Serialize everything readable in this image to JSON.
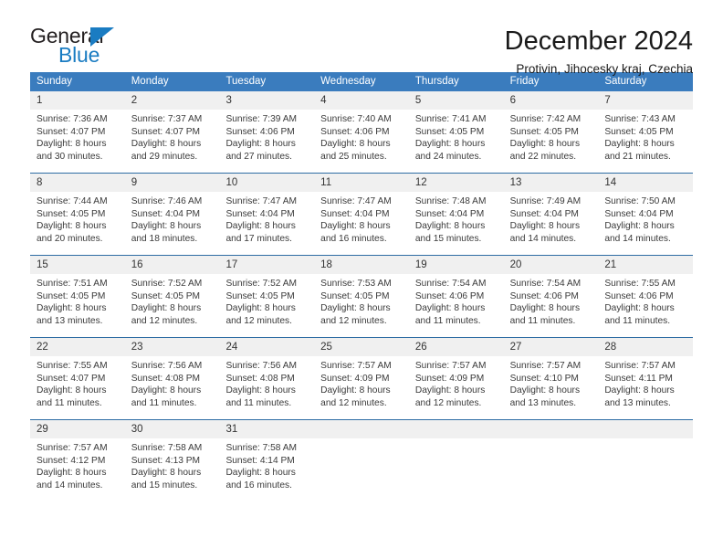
{
  "logo": {
    "word1": "General",
    "word2": "Blue",
    "accent_color": "#1a7cc2"
  },
  "header": {
    "title": "December 2024",
    "subtitle": "Protivin, Jihocesky kraj, Czechia"
  },
  "theme": {
    "header_row_bg": "#3a7cbe",
    "daynum_bg": "#f0f0f0",
    "divider": "#2e6da4",
    "text": "#3a3a3a"
  },
  "weekdays": [
    "Sunday",
    "Monday",
    "Tuesday",
    "Wednesday",
    "Thursday",
    "Friday",
    "Saturday"
  ],
  "weeks": [
    [
      {
        "day": "1",
        "sunrise": "Sunrise: 7:36 AM",
        "sunset": "Sunset: 4:07 PM",
        "daylight1": "Daylight: 8 hours",
        "daylight2": "and 30 minutes."
      },
      {
        "day": "2",
        "sunrise": "Sunrise: 7:37 AM",
        "sunset": "Sunset: 4:07 PM",
        "daylight1": "Daylight: 8 hours",
        "daylight2": "and 29 minutes."
      },
      {
        "day": "3",
        "sunrise": "Sunrise: 7:39 AM",
        "sunset": "Sunset: 4:06 PM",
        "daylight1": "Daylight: 8 hours",
        "daylight2": "and 27 minutes."
      },
      {
        "day": "4",
        "sunrise": "Sunrise: 7:40 AM",
        "sunset": "Sunset: 4:06 PM",
        "daylight1": "Daylight: 8 hours",
        "daylight2": "and 25 minutes."
      },
      {
        "day": "5",
        "sunrise": "Sunrise: 7:41 AM",
        "sunset": "Sunset: 4:05 PM",
        "daylight1": "Daylight: 8 hours",
        "daylight2": "and 24 minutes."
      },
      {
        "day": "6",
        "sunrise": "Sunrise: 7:42 AM",
        "sunset": "Sunset: 4:05 PM",
        "daylight1": "Daylight: 8 hours",
        "daylight2": "and 22 minutes."
      },
      {
        "day": "7",
        "sunrise": "Sunrise: 7:43 AM",
        "sunset": "Sunset: 4:05 PM",
        "daylight1": "Daylight: 8 hours",
        "daylight2": "and 21 minutes."
      }
    ],
    [
      {
        "day": "8",
        "sunrise": "Sunrise: 7:44 AM",
        "sunset": "Sunset: 4:05 PM",
        "daylight1": "Daylight: 8 hours",
        "daylight2": "and 20 minutes."
      },
      {
        "day": "9",
        "sunrise": "Sunrise: 7:46 AM",
        "sunset": "Sunset: 4:04 PM",
        "daylight1": "Daylight: 8 hours",
        "daylight2": "and 18 minutes."
      },
      {
        "day": "10",
        "sunrise": "Sunrise: 7:47 AM",
        "sunset": "Sunset: 4:04 PM",
        "daylight1": "Daylight: 8 hours",
        "daylight2": "and 17 minutes."
      },
      {
        "day": "11",
        "sunrise": "Sunrise: 7:47 AM",
        "sunset": "Sunset: 4:04 PM",
        "daylight1": "Daylight: 8 hours",
        "daylight2": "and 16 minutes."
      },
      {
        "day": "12",
        "sunrise": "Sunrise: 7:48 AM",
        "sunset": "Sunset: 4:04 PM",
        "daylight1": "Daylight: 8 hours",
        "daylight2": "and 15 minutes."
      },
      {
        "day": "13",
        "sunrise": "Sunrise: 7:49 AM",
        "sunset": "Sunset: 4:04 PM",
        "daylight1": "Daylight: 8 hours",
        "daylight2": "and 14 minutes."
      },
      {
        "day": "14",
        "sunrise": "Sunrise: 7:50 AM",
        "sunset": "Sunset: 4:04 PM",
        "daylight1": "Daylight: 8 hours",
        "daylight2": "and 14 minutes."
      }
    ],
    [
      {
        "day": "15",
        "sunrise": "Sunrise: 7:51 AM",
        "sunset": "Sunset: 4:05 PM",
        "daylight1": "Daylight: 8 hours",
        "daylight2": "and 13 minutes."
      },
      {
        "day": "16",
        "sunrise": "Sunrise: 7:52 AM",
        "sunset": "Sunset: 4:05 PM",
        "daylight1": "Daylight: 8 hours",
        "daylight2": "and 12 minutes."
      },
      {
        "day": "17",
        "sunrise": "Sunrise: 7:52 AM",
        "sunset": "Sunset: 4:05 PM",
        "daylight1": "Daylight: 8 hours",
        "daylight2": "and 12 minutes."
      },
      {
        "day": "18",
        "sunrise": "Sunrise: 7:53 AM",
        "sunset": "Sunset: 4:05 PM",
        "daylight1": "Daylight: 8 hours",
        "daylight2": "and 12 minutes."
      },
      {
        "day": "19",
        "sunrise": "Sunrise: 7:54 AM",
        "sunset": "Sunset: 4:06 PM",
        "daylight1": "Daylight: 8 hours",
        "daylight2": "and 11 minutes."
      },
      {
        "day": "20",
        "sunrise": "Sunrise: 7:54 AM",
        "sunset": "Sunset: 4:06 PM",
        "daylight1": "Daylight: 8 hours",
        "daylight2": "and 11 minutes."
      },
      {
        "day": "21",
        "sunrise": "Sunrise: 7:55 AM",
        "sunset": "Sunset: 4:06 PM",
        "daylight1": "Daylight: 8 hours",
        "daylight2": "and 11 minutes."
      }
    ],
    [
      {
        "day": "22",
        "sunrise": "Sunrise: 7:55 AM",
        "sunset": "Sunset: 4:07 PM",
        "daylight1": "Daylight: 8 hours",
        "daylight2": "and 11 minutes."
      },
      {
        "day": "23",
        "sunrise": "Sunrise: 7:56 AM",
        "sunset": "Sunset: 4:08 PM",
        "daylight1": "Daylight: 8 hours",
        "daylight2": "and 11 minutes."
      },
      {
        "day": "24",
        "sunrise": "Sunrise: 7:56 AM",
        "sunset": "Sunset: 4:08 PM",
        "daylight1": "Daylight: 8 hours",
        "daylight2": "and 11 minutes."
      },
      {
        "day": "25",
        "sunrise": "Sunrise: 7:57 AM",
        "sunset": "Sunset: 4:09 PM",
        "daylight1": "Daylight: 8 hours",
        "daylight2": "and 12 minutes."
      },
      {
        "day": "26",
        "sunrise": "Sunrise: 7:57 AM",
        "sunset": "Sunset: 4:09 PM",
        "daylight1": "Daylight: 8 hours",
        "daylight2": "and 12 minutes."
      },
      {
        "day": "27",
        "sunrise": "Sunrise: 7:57 AM",
        "sunset": "Sunset: 4:10 PM",
        "daylight1": "Daylight: 8 hours",
        "daylight2": "and 13 minutes."
      },
      {
        "day": "28",
        "sunrise": "Sunrise: 7:57 AM",
        "sunset": "Sunset: 4:11 PM",
        "daylight1": "Daylight: 8 hours",
        "daylight2": "and 13 minutes."
      }
    ],
    [
      {
        "day": "29",
        "sunrise": "Sunrise: 7:57 AM",
        "sunset": "Sunset: 4:12 PM",
        "daylight1": "Daylight: 8 hours",
        "daylight2": "and 14 minutes."
      },
      {
        "day": "30",
        "sunrise": "Sunrise: 7:58 AM",
        "sunset": "Sunset: 4:13 PM",
        "daylight1": "Daylight: 8 hours",
        "daylight2": "and 15 minutes."
      },
      {
        "day": "31",
        "sunrise": "Sunrise: 7:58 AM",
        "sunset": "Sunset: 4:14 PM",
        "daylight1": "Daylight: 8 hours",
        "daylight2": "and 16 minutes."
      },
      {
        "day": "",
        "sunrise": "",
        "sunset": "",
        "daylight1": "",
        "daylight2": ""
      },
      {
        "day": "",
        "sunrise": "",
        "sunset": "",
        "daylight1": "",
        "daylight2": ""
      },
      {
        "day": "",
        "sunrise": "",
        "sunset": "",
        "daylight1": "",
        "daylight2": ""
      },
      {
        "day": "",
        "sunrise": "",
        "sunset": "",
        "daylight1": "",
        "daylight2": ""
      }
    ]
  ]
}
